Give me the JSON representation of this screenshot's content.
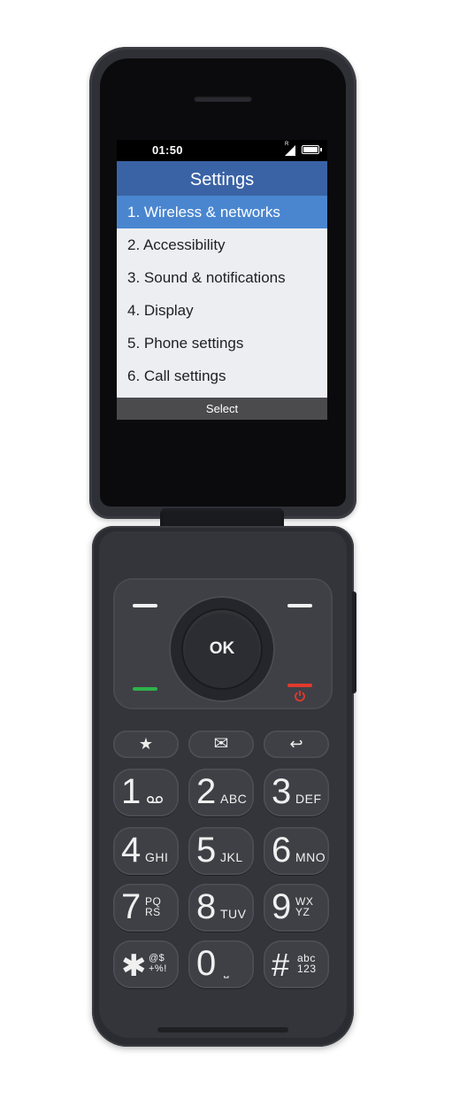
{
  "status_bar": {
    "time": "01:50",
    "roaming_mark": "R",
    "signal_icon": "signal-icon",
    "battery_icon": "battery-icon",
    "battery_level": 1.0
  },
  "screen": {
    "title": "Settings",
    "menu_items": [
      {
        "label": "1. Wireless & networks",
        "selected": true
      },
      {
        "label": "2. Accessibility",
        "selected": false
      },
      {
        "label": "3. Sound & notifications",
        "selected": false
      },
      {
        "label": "4. Display",
        "selected": false
      },
      {
        "label": "5. Phone settings",
        "selected": false
      },
      {
        "label": "6. Call settings",
        "selected": false
      }
    ],
    "center_softkey": "Select"
  },
  "nav": {
    "ok_label": "OK",
    "left_softkey_icon": "dash-icon",
    "right_softkey_icon": "dash-icon",
    "call_key_icon": "call-icon",
    "end_key_icon": "power-icon",
    "call_color": "#2db34a",
    "end_color": "#e03a2e"
  },
  "function_keys": {
    "star_glyph": "★",
    "message_glyph": "✉",
    "back_glyph": "↩"
  },
  "keypad": [
    {
      "digit": "1",
      "letters": "",
      "icon": "voicemail-icon"
    },
    {
      "digit": "2",
      "letters": "ABC"
    },
    {
      "digit": "3",
      "letters": "DEF"
    },
    {
      "digit": "4",
      "letters": "GHI"
    },
    {
      "digit": "5",
      "letters": "JKL"
    },
    {
      "digit": "6",
      "letters": "MNO"
    },
    {
      "digit": "7",
      "letters_top": "PQ",
      "letters_bottom": "RS"
    },
    {
      "digit": "8",
      "letters": "TUV"
    },
    {
      "digit": "9",
      "letters_top": "WX",
      "letters_bottom": "YZ"
    },
    {
      "digit": "✱",
      "letters_top": "@$",
      "letters_bottom": "+%!"
    },
    {
      "digit": "0",
      "letters": "⎵"
    },
    {
      "digit": "#",
      "letters_top": "abc",
      "letters_bottom": "123"
    }
  ],
  "colors": {
    "header_blue": "#3a63a5",
    "selection_blue": "#4a86d0",
    "body": "#2f3036"
  }
}
